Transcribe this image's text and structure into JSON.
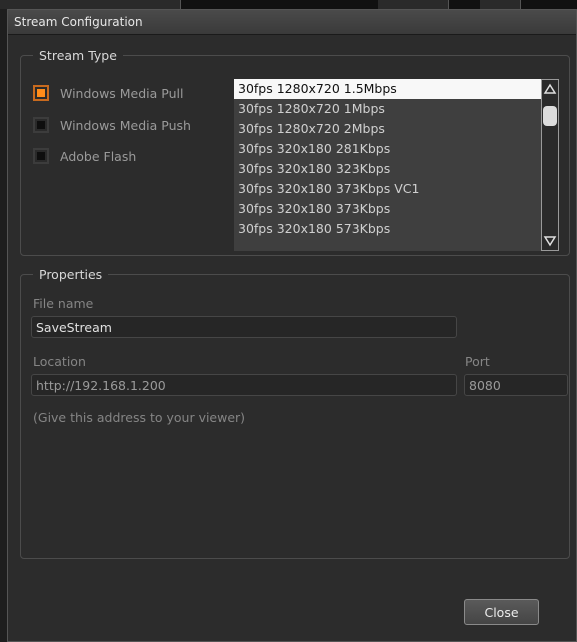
{
  "window": {
    "title": "Stream Configuration"
  },
  "stream_type": {
    "legend": "Stream Type",
    "options": [
      {
        "label": "Windows Media Pull",
        "selected": true
      },
      {
        "label": "Windows Media Push",
        "selected": false
      },
      {
        "label": "Adobe Flash",
        "selected": false
      }
    ],
    "profiles": [
      "30fps 1280x720 1.5Mbps",
      "30fps 1280x720 1Mbps",
      "30fps 1280x720 2Mbps",
      "30fps 320x180 281Kbps",
      "30fps 320x180 323Kbps",
      "30fps 320x180 373Kbps VC1",
      "30fps 320x180 373Kbps",
      "30fps 320x180 573Kbps"
    ],
    "selected_profile": "30fps 1280x720 1.5Mbps"
  },
  "properties": {
    "legend": "Properties",
    "file_name_label": "File name",
    "file_name_value": "SaveStream",
    "location_label": "Location",
    "location_value": "http://192.168.1.200",
    "port_label": "Port",
    "port_value": "8080",
    "hint": "(Give this address to your viewer)"
  },
  "actions": {
    "close_label": "Close"
  },
  "colors": {
    "accent": "#ff8c1a",
    "selection_bg": "#f8f8f8",
    "panel_bg": "#2c2c2c"
  }
}
